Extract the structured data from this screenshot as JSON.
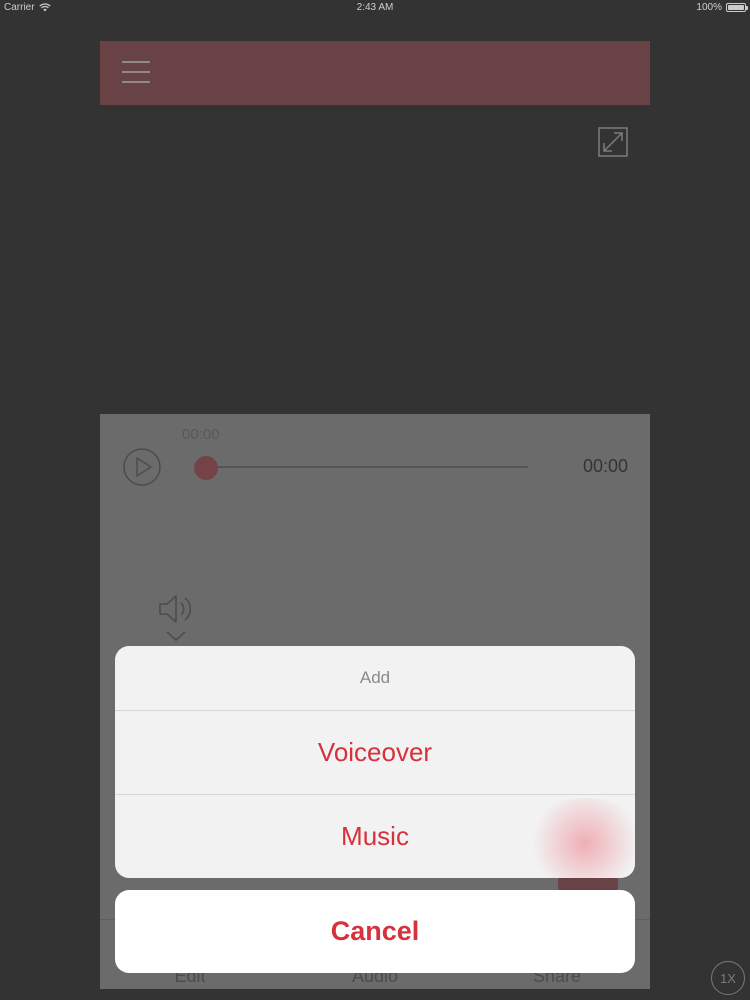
{
  "status_bar": {
    "carrier": "Carrier",
    "time": "2:43 AM",
    "battery": "100%"
  },
  "player": {
    "elapsed_label": "00:00",
    "duration_label": "00:00",
    "progress": 0
  },
  "tabs": [
    {
      "label": "Edit"
    },
    {
      "label": "Audio"
    },
    {
      "label": "Share"
    }
  ],
  "action_sheet": {
    "title": "Add",
    "options": [
      {
        "label": "Voiceover"
      },
      {
        "label": "Music"
      }
    ],
    "cancel_label": "Cancel"
  },
  "speed": {
    "label": "1X"
  },
  "colors": {
    "brand": "#9a2a33",
    "destructive_text": "#d6313c"
  }
}
